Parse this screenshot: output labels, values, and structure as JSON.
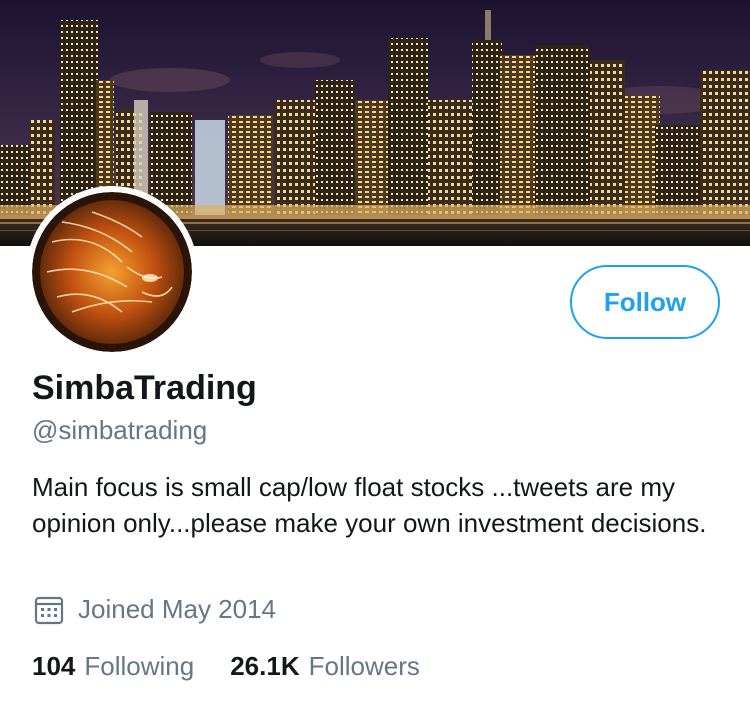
{
  "profile": {
    "display_name": "SimbaTrading",
    "handle": "@simbatrading",
    "bio": "Main focus is small cap/low float stocks ...tweets are my opinion only...please make your own investment decisions.",
    "joined": "Joined May 2014",
    "follow_label": "Follow"
  },
  "stats": {
    "following_count": "104",
    "following_label": "Following",
    "followers_count": "26.1K",
    "followers_label": "Followers"
  },
  "icons": {
    "joined": "calendar-icon"
  },
  "colors": {
    "accent": "#1da1f2",
    "secondary_text": "#657786",
    "primary_text": "#14171a"
  }
}
